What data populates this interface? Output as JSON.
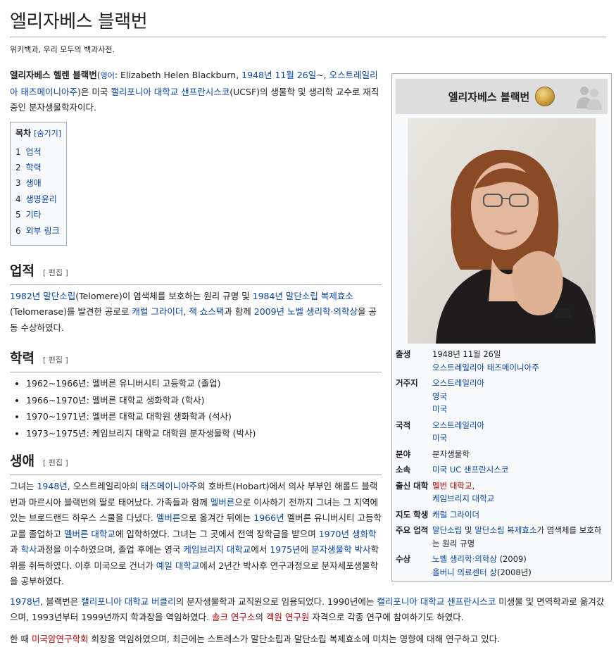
{
  "title": "엘리자베스 블랙번",
  "tagline": "위키백과, 우리 모두의 백과사전.",
  "intro": {
    "name_bold": "엘리자베스 헬렌 블랙번",
    "paren_open": "(",
    "lang_label": "영어",
    "en_name": ": Elizabeth Helen Blackburn, ",
    "birth_link": "1948년 11월 26일",
    "tilde": "~, ",
    "place_link": "오스트레일리아 태즈메이니아주",
    "t1": ")은 미국 ",
    "ucsf_link": "캘리포니아 대학교 샌프란시스코",
    "t2": "(UCSF)의 생물학 및 생리학 교수로 재직 중인 분자생물학자이다."
  },
  "toc": {
    "title": "목차",
    "hide": "[숨기기]",
    "items": [
      {
        "num": "1",
        "label": "업적"
      },
      {
        "num": "2",
        "label": "학력"
      },
      {
        "num": "3",
        "label": "생애"
      },
      {
        "num": "4",
        "label": "생명윤리"
      },
      {
        "num": "5",
        "label": "기타"
      },
      {
        "num": "6",
        "label": "외부 링크"
      }
    ]
  },
  "edit_label": "[ 편집 ]",
  "sec1": {
    "heading": "업적",
    "l1": "1982년 말단소립",
    "t1": "(Telomere)이 염색체를 보호하는 원리 규명 및 ",
    "l2": "1984년 말단소립 복제효소",
    "t2": "(Telomerase)를 발견한 공로로 ",
    "l3": "캐럴 그라이더",
    "t3": ", ",
    "l4": "잭 쇼스택",
    "t4": "과 함께 ",
    "l5": "2009년 노벨 생리학·의학상",
    "t5": "을 공동 수상하였다."
  },
  "sec2": {
    "heading": "학력",
    "items": [
      "1962~1966년: 멜버른 유니버시티 고등학교 (졸업)",
      "1966~1970년: 멜버른 대학교 생화학과 (학사)",
      "1970~1971년: 멜버른 대학교 대학원 생화학과 (석사)",
      "1973~1975년: 케임브리지 대학교 대학원 분자생물학 (박사)"
    ]
  },
  "sec3": {
    "heading": "생애",
    "p1": [
      {
        "t": "그녀는 "
      },
      {
        "l": "1948년"
      },
      {
        "t": ", 오스트레일리아의 "
      },
      {
        "l": "태즈메이니아주"
      },
      {
        "t": "의 호바트(Hobart)에서 의사 부부인 해롤드 블랙번과 마르시아 블랙번의 딸로 태어났다. 가족들과 함께 "
      },
      {
        "l": "멜버른"
      },
      {
        "t": "으로 이사하기 전까지 그녀는 그 지역에 있는 브로드랜드 하우스 스쿨을 다녔다. "
      },
      {
        "l": "멜버른"
      },
      {
        "t": "으로 옮겨간 뒤에는 "
      },
      {
        "l": "1966년"
      },
      {
        "t": " 멜버른 유니버시티 고등학교를 졸업하고 "
      },
      {
        "l": "멜버른 대학교"
      },
      {
        "t": "에 입학하였다. 그녀는 그 곳에서 전액 장학금을 받으며 "
      },
      {
        "l": "1970년"
      },
      {
        "t": " "
      },
      {
        "l": "생화학"
      },
      {
        "t": "과 "
      },
      {
        "l": "학사"
      },
      {
        "t": "과정을 이수하였으며, 졸업 후에는 영국 "
      },
      {
        "l": "케임브리지 대학교"
      },
      {
        "t": "에서 "
      },
      {
        "l": "1975년"
      },
      {
        "t": "에 "
      },
      {
        "l": "분자생물학"
      },
      {
        "t": " "
      },
      {
        "l": "박사"
      },
      {
        "t": "학위를 취득하였다. 이후 미국으로 건너가 "
      },
      {
        "l": "예일 대학교"
      },
      {
        "t": "에서 2년간 박사후 연구과정으로 분자세포생물학을 공부하였다."
      }
    ],
    "p2": [
      {
        "l": "1978년"
      },
      {
        "t": ", 블랙번은 "
      },
      {
        "l": "캘리포니아 대학교 버클리"
      },
      {
        "t": "의 분자생물학과 교직원으로 임용되었다. 1990년에는 "
      },
      {
        "l": "캘리포니아 대학교 샌프란시스코"
      },
      {
        "t": " 미생물 및 면역학과로 옮겨갔으며, 1993년부터 1999년까지 학과장을 역임하였다. "
      },
      {
        "r": "솔크 연구소"
      },
      {
        "t": "의 "
      },
      {
        "r": "객원 연구원"
      },
      {
        "t": " 자격으로 각종 연구에 참여하기도 하였다."
      }
    ],
    "p3": [
      {
        "t": "한 때 "
      },
      {
        "r": "미국암연구학회"
      },
      {
        "t": " 회장을 역임하였으며, 최근에는 스트레스가 말단소립과 말단소립 복제효소에 미치는 영향에 대해 연구하고 있다."
      }
    ]
  },
  "infobox": {
    "title": "엘리자베스 블랙번",
    "rows": [
      {
        "key": "출생",
        "lines": [
          [
            {
              "t": "1948년 11월 26일"
            }
          ],
          [
            {
              "l": "오스트레일리아 태즈메이니아주"
            }
          ]
        ]
      },
      {
        "key": "거주지",
        "lines": [
          [
            {
              "l": "오스트레일리아"
            }
          ],
          [
            {
              "l": "영국"
            }
          ],
          [
            {
              "l": "미국"
            }
          ]
        ]
      },
      {
        "key": "국적",
        "lines": [
          [
            {
              "l": "오스트레일리아"
            }
          ],
          [
            {
              "l": "미국"
            }
          ]
        ]
      },
      {
        "key": "분야",
        "lines": [
          [
            {
              "t": "분자생물학"
            }
          ]
        ]
      },
      {
        "key": "소속",
        "lines": [
          [
            {
              "l": "미국 UC 샌프란시스코"
            }
          ]
        ]
      },
      {
        "key": "출신 대학",
        "lines": [
          [
            {
              "r": "멜번 대학교"
            },
            {
              "t": ","
            }
          ],
          [
            {
              "l": "케임브리지 대학교"
            }
          ]
        ]
      },
      {
        "key": "지도 학생",
        "lines": [
          [
            {
              "l": "캐럴 그라이더"
            }
          ]
        ]
      },
      {
        "key": "주요 업적",
        "lines": [
          [
            {
              "l": "말단소립"
            },
            {
              "t": " 및 "
            },
            {
              "l": "말단소립 복제효소"
            },
            {
              "t": "가 염색체를 보호하"
            }
          ],
          [
            {
              "t": "는 원리 규명"
            }
          ]
        ]
      },
      {
        "key": "수상",
        "lines": [
          [
            {
              "l": "노벨 생리학·의학상"
            },
            {
              "t": " (2009)"
            }
          ],
          [
            {
              "l": "올버니 의료센터 상"
            },
            {
              "t": "(2008년)"
            }
          ]
        ]
      }
    ]
  },
  "colors": {
    "link": "#0645ad",
    "redlink": "#ba0000",
    "border": "#a2a9b1",
    "infobox_title_bg": "#dddddd"
  }
}
